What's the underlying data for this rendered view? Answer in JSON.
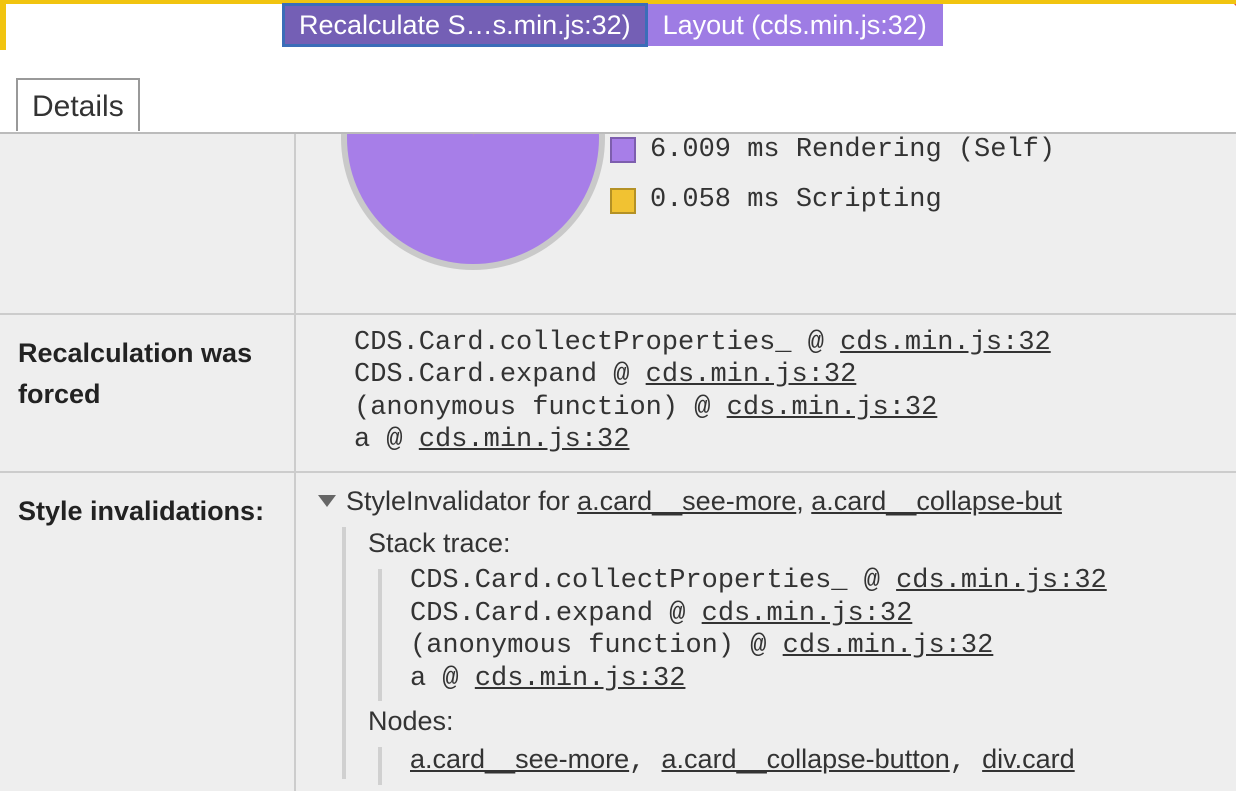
{
  "chart_data": {
    "type": "pie",
    "title": "",
    "series": [
      {
        "name": "Rendering (Self)",
        "value": 6.009,
        "color": "#a77ee8"
      },
      {
        "name": "Scripting",
        "value": 0.058,
        "color": "#f1c232"
      }
    ]
  },
  "timeline": {
    "tabs": [
      {
        "label": "Recalculate S…s.min.js:32)",
        "selected": true
      },
      {
        "label": "Layout (cds.min.js:32)",
        "selected": false
      }
    ]
  },
  "detailsTab": "Details",
  "legend": {
    "rendering": "6.009 ms Rendering (Self)",
    "scripting": "0.058 ms Scripting"
  },
  "sections": {
    "recalcForced": {
      "label": "Recalculation was forced",
      "stack": [
        {
          "fn": "CDS.Card.collectProperties_",
          "at": "@",
          "src": "cds.min.js:32"
        },
        {
          "fn": "CDS.Card.expand",
          "at": "@",
          "src": "cds.min.js:32"
        },
        {
          "fn": "(anonymous function)",
          "at": "@",
          "src": "cds.min.js:32"
        },
        {
          "fn": "a",
          "at": "@",
          "src": "cds.min.js:32"
        }
      ]
    },
    "styleInvalid": {
      "label": "Style invalidations:",
      "header_prefix": "StyleInvalidator for ",
      "header_links": [
        "a.card__see-more",
        "a.card__collapse-but"
      ],
      "sep": ", ",
      "stack_label": "Stack trace:",
      "stack": [
        {
          "fn": "CDS.Card.collectProperties_",
          "at": "@",
          "src": "cds.min.js:32"
        },
        {
          "fn": "CDS.Card.expand",
          "at": "@",
          "src": "cds.min.js:32"
        },
        {
          "fn": "(anonymous function)",
          "at": "@",
          "src": "cds.min.js:32"
        },
        {
          "fn": "a",
          "at": "@",
          "src": "cds.min.js:32"
        }
      ],
      "nodes_label": "Nodes:",
      "nodes": [
        "a.card__see-more",
        "a.card__collapse-button",
        "div.card"
      ]
    }
  }
}
